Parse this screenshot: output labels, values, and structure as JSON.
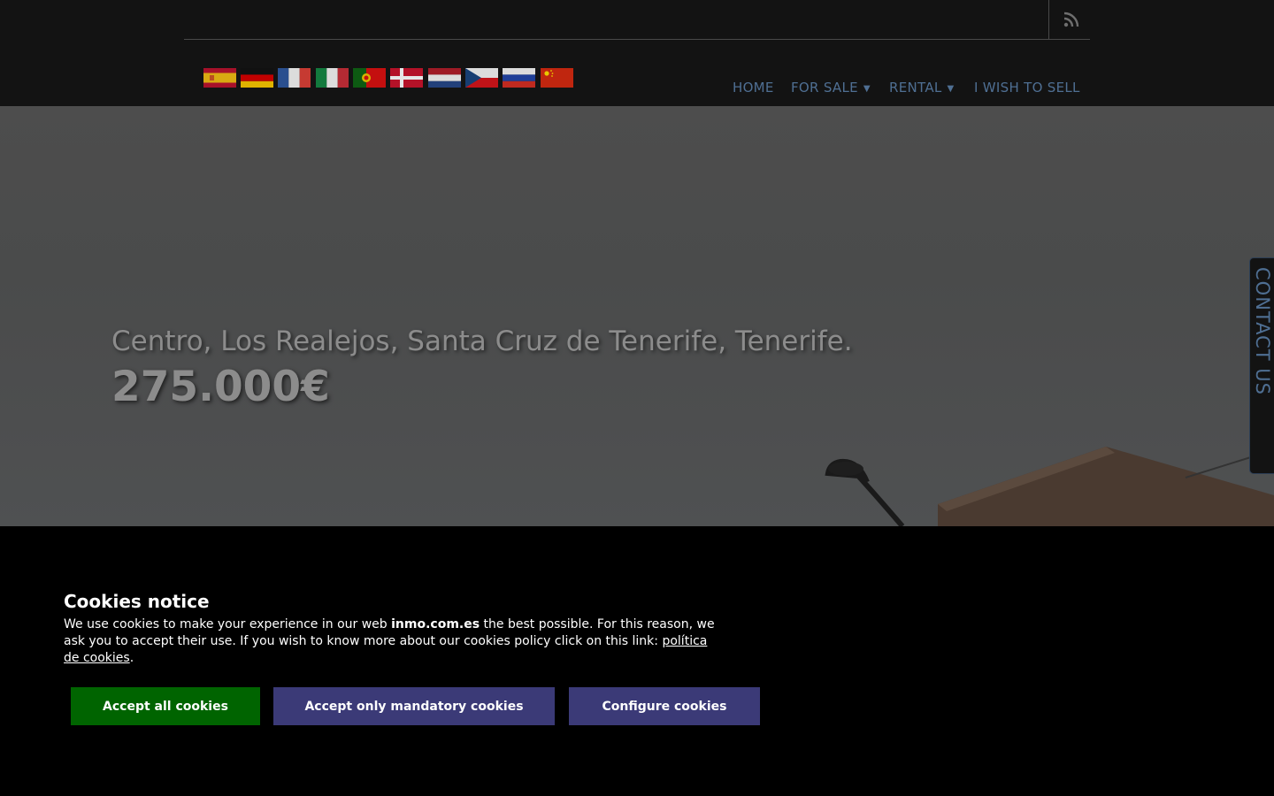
{
  "header": {
    "rss_icon": "rss-icon",
    "languages": [
      {
        "name": "flag-spain-icon",
        "colors": [
          "#c60b1e",
          "#ffc400",
          "#c60b1e"
        ]
      },
      {
        "name": "flag-germany-icon",
        "colors": [
          "#000000",
          "#dd0000",
          "#ffce00"
        ]
      },
      {
        "name": "flag-france-icon",
        "colors": [
          "#0055a4",
          "#ffffff",
          "#ef4135"
        ]
      },
      {
        "name": "flag-italy-icon",
        "colors": [
          "#009246",
          "#ffffff",
          "#ce2b37"
        ]
      },
      {
        "name": "flag-portugal-icon",
        "colors": [
          "#006600",
          "#ff0000"
        ]
      },
      {
        "name": "flag-denmark-icon",
        "colors": [
          "#c8102e",
          "#ffffff"
        ]
      },
      {
        "name": "flag-netherlands-icon",
        "colors": [
          "#ae1c28",
          "#ffffff",
          "#21468b"
        ]
      },
      {
        "name": "flag-czech-icon",
        "colors": [
          "#ffffff",
          "#d7141a",
          "#11457e"
        ]
      },
      {
        "name": "flag-russia-icon",
        "colors": [
          "#ffffff",
          "#0039a6",
          "#d52b1e"
        ]
      },
      {
        "name": "flag-china-icon",
        "colors": [
          "#de2910",
          "#ffde00"
        ]
      }
    ],
    "nav": {
      "home": "HOME",
      "for_sale": "FOR SALE",
      "rental": "RENTAL",
      "sell": "I WISH TO SELL",
      "caret": "▼"
    }
  },
  "hero": {
    "location": "Centro, Los Realejos, Santa Cruz de Tenerife, Tenerife.",
    "price": "275.000€"
  },
  "contact_tab": "CONTACT US",
  "cookies": {
    "title": "Cookies notice",
    "text_before": "We use cookies to make your experience in our web ",
    "site": "inmo.com.es",
    "text_after": " the best possible. For this reason, we ask you to accept their use. If you wish to know more about our cookies policy click on this link: ",
    "link": "política de cookies",
    "text_end": ".",
    "accept_all": "Accept all cookies",
    "accept_mandatory": "Accept only mandatory cookies",
    "configure": "Configure cookies"
  },
  "colors": {
    "nav_text": "#4f6f93",
    "accept_button": "#006400",
    "secondary_button": "#3b3a77"
  }
}
